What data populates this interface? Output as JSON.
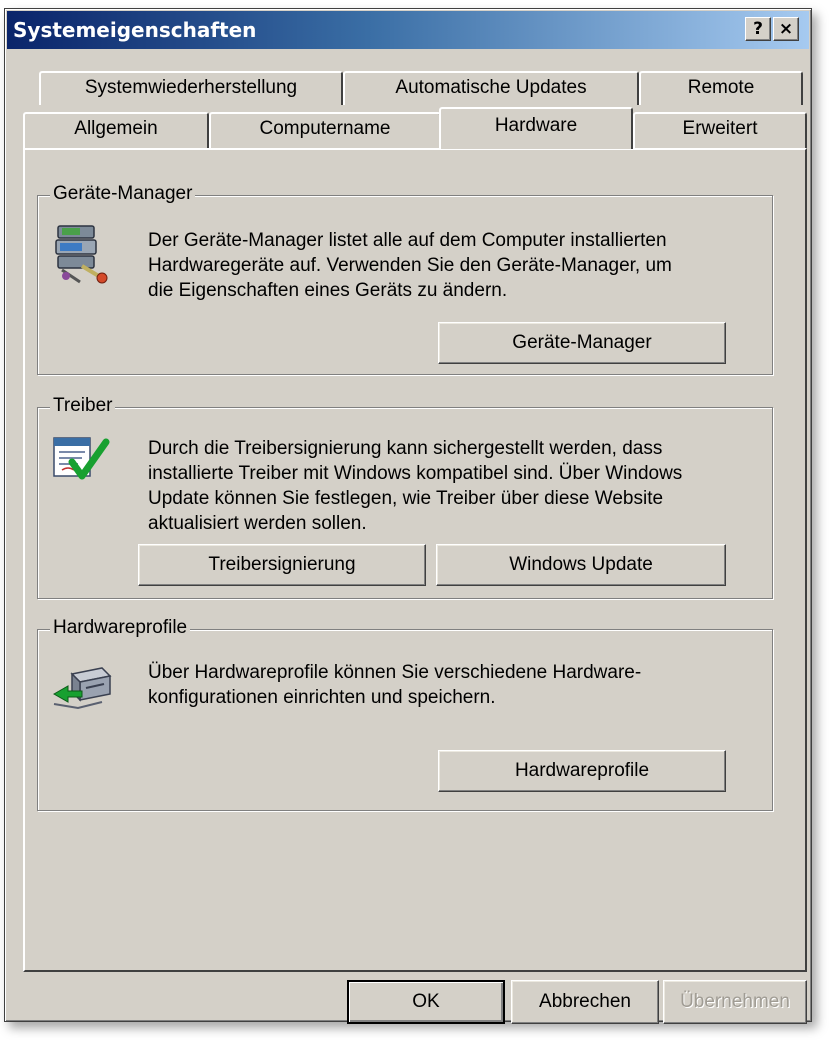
{
  "window": {
    "title": "Systemeigenschaften",
    "help_button": "?",
    "close_button": "×"
  },
  "tabs": {
    "row1": [
      "Systemwiederherstellung",
      "Automatische Updates",
      "Remote"
    ],
    "row2": [
      "Allgemein",
      "Computername",
      "Hardware",
      "Erweitert"
    ],
    "selected": "Hardware"
  },
  "groups": {
    "device_manager": {
      "legend": "Geräte-Manager",
      "lines": [
        "Der Geräte-Manager listet alle auf dem Computer installierten",
        "Hardwaregeräte auf. Verwenden Sie den Geräte-Manager, um",
        "die Eigenschaften eines Geräts zu ändern."
      ],
      "button": "Geräte-Manager",
      "icon": "device-manager-icon"
    },
    "drivers": {
      "legend": "Treiber",
      "lines": [
        "Durch die Treibersignierung kann sichergestellt werden, dass",
        "installierte Treiber mit Windows kompatibel sind. Über Windows",
        "Update können Sie festlegen, wie Treiber über diese Website",
        "aktualisiert werden sollen."
      ],
      "button_signing": "Treibersignierung",
      "button_update": "Windows Update",
      "icon": "driver-signing-icon"
    },
    "hardware_profiles": {
      "legend": "Hardwareprofile",
      "lines": [
        "Über Hardwareprofile können Sie verschiedene Hardware-",
        "konfigurationen einrichten und speichern."
      ],
      "button": "Hardwareprofile",
      "icon": "hardware-profile-icon"
    }
  },
  "footer": {
    "ok": "OK",
    "cancel": "Abbrechen",
    "apply": "Übernehmen",
    "apply_enabled": false
  },
  "colors": {
    "face": "#d4d0c8",
    "title_start": "#0a246a",
    "title_end": "#a6caf0",
    "check_green": "#18a030"
  }
}
